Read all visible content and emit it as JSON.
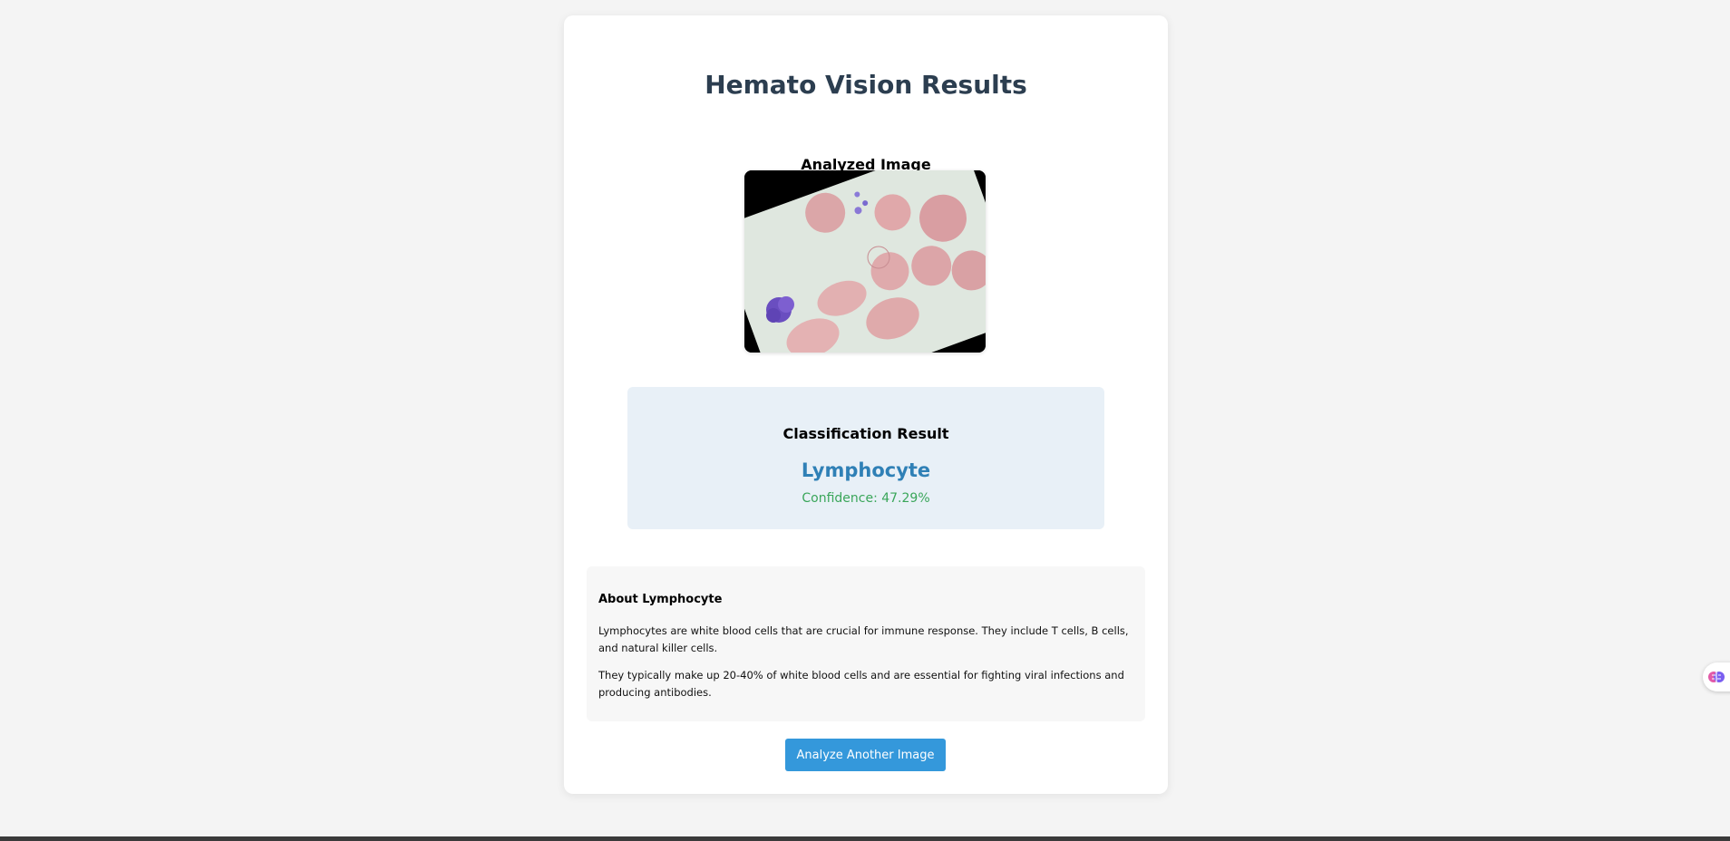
{
  "page": {
    "title": "Hemato Vision Results"
  },
  "image_section": {
    "title": "Analyzed Image",
    "image_icon": "blood-smear-image"
  },
  "result": {
    "heading": "Classification Result",
    "class_name": "Lymphocyte",
    "confidence_text": "Confidence: 47.29%",
    "confidence_value": 47.29
  },
  "about": {
    "heading": "About Lymphocyte",
    "paragraphs": [
      "Lymphocytes are white blood cells that are crucial for immune response. They include T cells, B cells, and natural killer cells.",
      "They typically make up 20-40% of white blood cells and are essential for fighting viral infections and producing antibodies."
    ]
  },
  "actions": {
    "analyze_another_label": "Analyze Another Image"
  },
  "widget": {
    "icon": "extension-brain-icon"
  },
  "colors": {
    "title": "#2c3e50",
    "class_name": "#2f80b6",
    "confidence": "#3aa65a",
    "button": "#3498db",
    "result_bg": "#e8f0f7"
  }
}
